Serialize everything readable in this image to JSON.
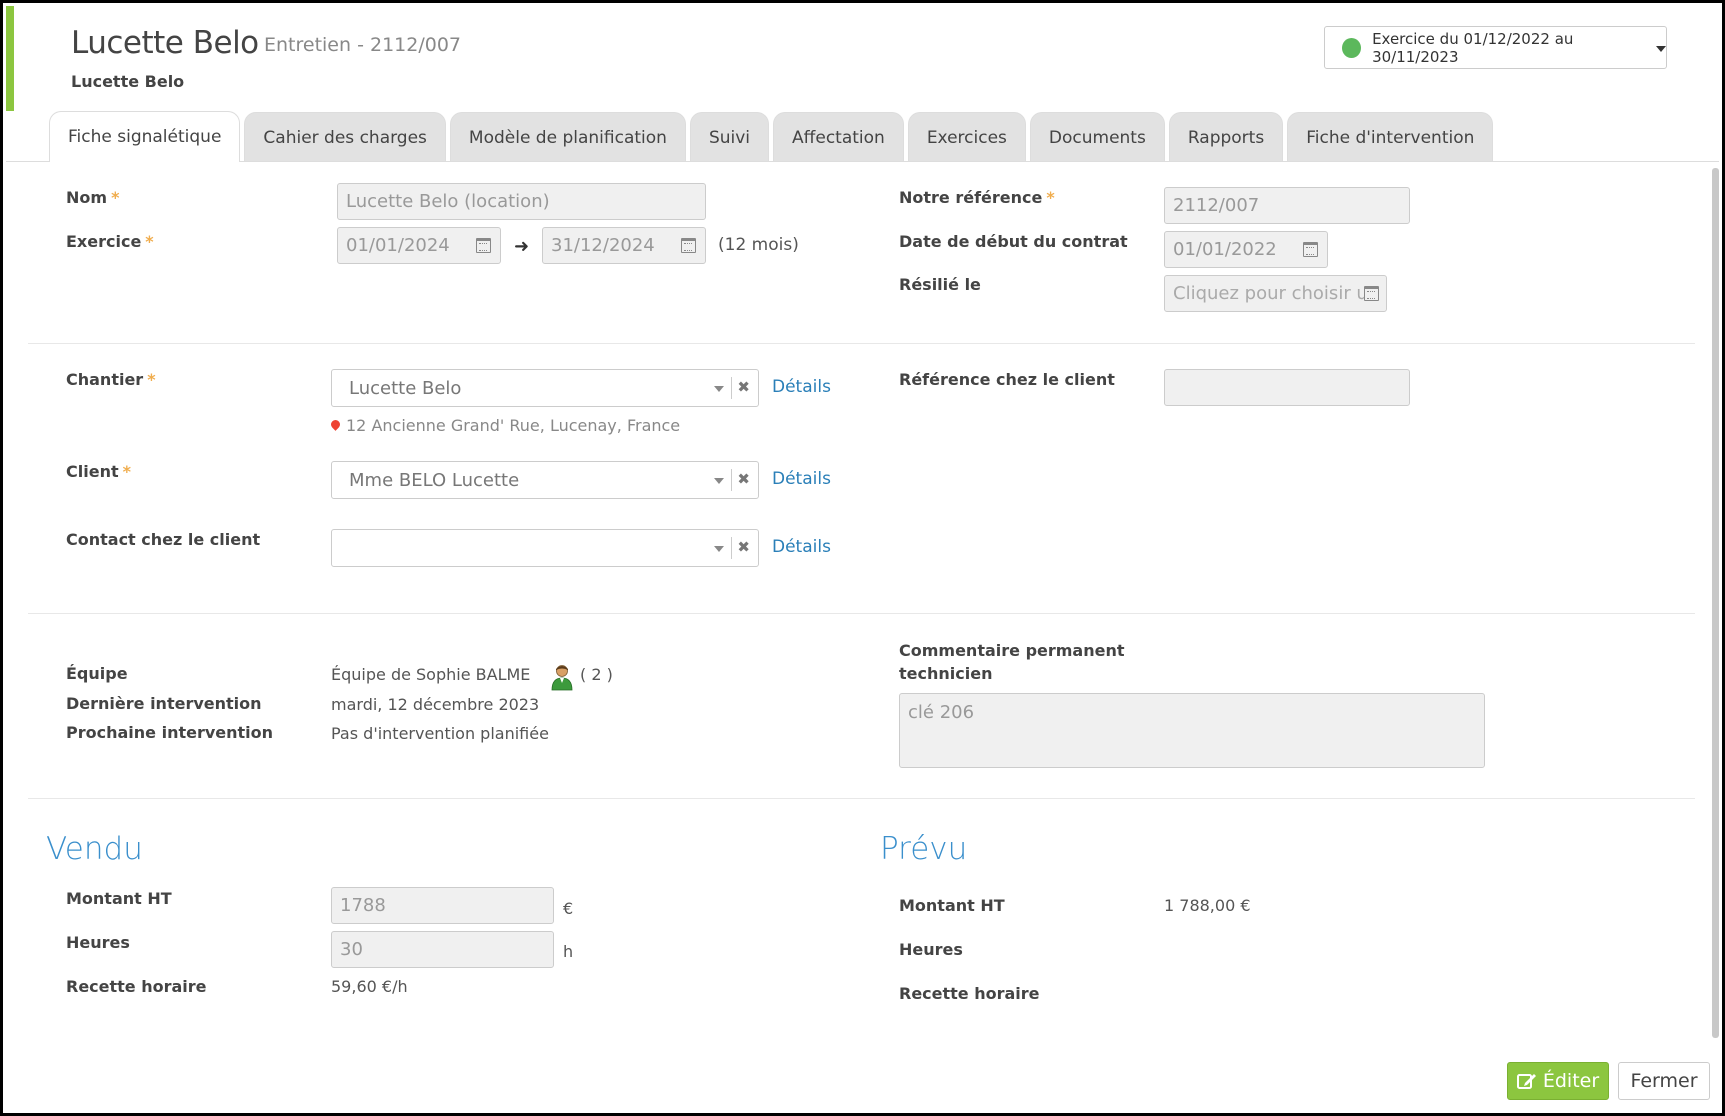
{
  "header": {
    "title": "Lucette Belo",
    "subtitle": "Entretien - 2112/007",
    "client_name": "Lucette Belo",
    "exercice_label": "Exercice du 01/12/2022 au 30/11/2023"
  },
  "tabs": [
    {
      "label": "Fiche signalétique"
    },
    {
      "label": "Cahier des charges"
    },
    {
      "label": "Modèle de planification"
    },
    {
      "label": "Suivi"
    },
    {
      "label": "Affectation"
    },
    {
      "label": "Exercices"
    },
    {
      "label": "Documents"
    },
    {
      "label": "Rapports"
    },
    {
      "label": "Fiche d'intervention"
    }
  ],
  "form": {
    "nom_label": "Nom",
    "nom_value": "Lucette Belo (location)",
    "exercice_label": "Exercice",
    "exercice_start": "01/01/2024",
    "exercice_end": "31/12/2024",
    "exercice_duration": "(12 mois)",
    "notre_ref_label": "Notre référence",
    "notre_ref_value": "2112/007",
    "date_debut_label": "Date de début du contrat",
    "date_debut_value": "01/01/2022",
    "resilie_label": "Résilié le",
    "resilie_placeholder": "Cliquez pour choisir une date",
    "chantier_label": "Chantier",
    "chantier_value": "Lucette Belo",
    "chantier_address": "12 Ancienne Grand' Rue, Lucenay, France",
    "client_label": "Client",
    "client_value": "Mme BELO Lucette",
    "contact_label": "Contact chez le client",
    "contact_value": "",
    "details_label": "Détails",
    "ref_client_label": "Référence chez le client",
    "ref_client_value": "",
    "required_mark": "*"
  },
  "info": {
    "equipe_label": "Équipe",
    "equipe_value": "Équipe de Sophie BALME",
    "equipe_count": "( 2 )",
    "derniere_label": "Dernière intervention",
    "derniere_value": "mardi, 12 décembre 2023",
    "prochaine_label": "Prochaine intervention",
    "prochaine_value": "Pas d'intervention planifiée",
    "commentaire_label_1": "Commentaire permanent",
    "commentaire_label_2": "technicien",
    "commentaire_value": "clé 206"
  },
  "vendu": {
    "title": "Vendu",
    "montant_label": "Montant HT",
    "montant_value": "1788",
    "montant_unit": "€",
    "heures_label": "Heures",
    "heures_value": "30",
    "heures_unit": "h",
    "recette_label": "Recette horaire",
    "recette_value": "59,60 €/h"
  },
  "prevu": {
    "title": "Prévu",
    "montant_label": "Montant HT",
    "montant_value": "1 788,00 €",
    "heures_label": "Heures",
    "recette_label": "Recette horaire"
  },
  "actions": {
    "edit_label": "Éditer",
    "close_label": "Fermer"
  },
  "colors": {
    "accent": "#8cc63f",
    "link": "#2a7fb8",
    "section_title": "#3a8fcc",
    "status_dot": "#5cb85c"
  },
  "icons": {
    "status": "green-status-dot-icon",
    "calendar": "calendar-icon",
    "arrow": "arrow-right-icon",
    "pin": "map-pin-icon",
    "team": "user-team-icon",
    "edit": "edit-icon"
  }
}
